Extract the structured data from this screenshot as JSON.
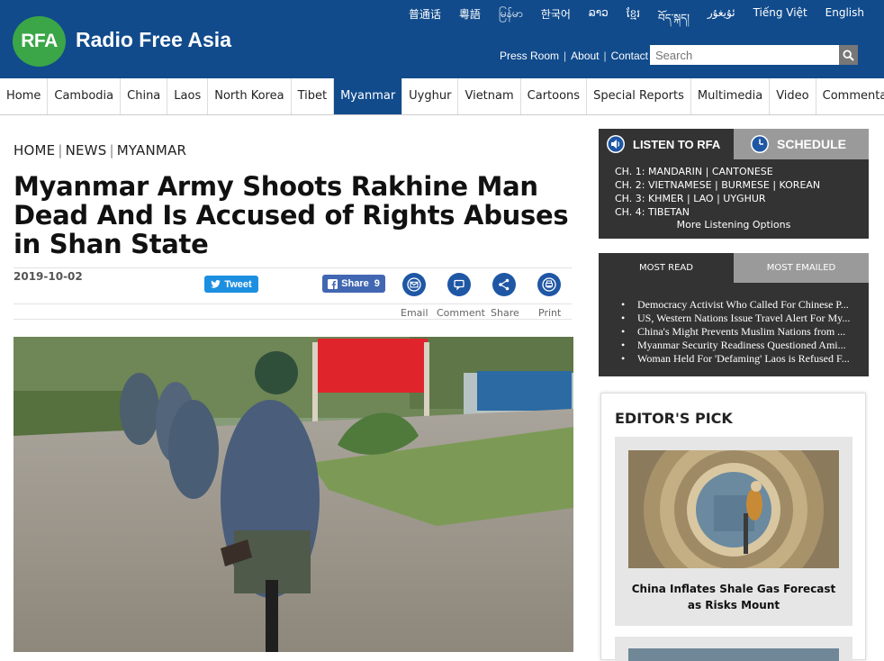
{
  "header": {
    "logo_mark": "RFA",
    "site_name": "Radio Free Asia",
    "languages": [
      "普通话",
      "粵語",
      "မြန်မာ",
      "한국어",
      "ລາວ",
      "ខ្មែរ",
      "བོད་སྐད།",
      "ئۇيغۇر",
      "Tiếng Việt",
      "English"
    ],
    "utility_links": [
      "Press Room",
      "About",
      "Contact"
    ],
    "search_placeholder": "Search",
    "brand_color": "#114b8c",
    "logo_color": "#3aa648"
  },
  "nav": {
    "items": [
      "Home",
      "Cambodia",
      "China",
      "Laos",
      "North Korea",
      "Tibet",
      "Myanmar",
      "Uyghur",
      "Vietnam",
      "Cartoons",
      "Special Reports",
      "Multimedia",
      "Video",
      "Commentaries"
    ],
    "active": "Myanmar"
  },
  "article": {
    "breadcrumb": [
      "HOME",
      "NEWS",
      "MYANMAR"
    ],
    "headline": "Myanmar Army Shoots Rakhine Man Dead And Is Accused of Rights Abuses in Shan State",
    "date": "2019-10-02",
    "tweet_label": "Tweet",
    "fb_label": "Share",
    "fb_count": "9",
    "share_actions": [
      "Email",
      "Comment",
      "Share",
      "Print"
    ]
  },
  "sidebar": {
    "listen_label": "LISTEN TO RFA",
    "schedule_label": "SCHEDULE",
    "channels": [
      "CH. 1: MANDARIN | CANTONESE",
      "CH. 2: VIETNAMESE | BURMESE | KOREAN",
      "CH. 3: KHMER | LAO | UYGHUR",
      "CH. 4: TIBETAN"
    ],
    "more_listening": "More Listening Options",
    "most_read_label": "MOST READ",
    "most_emailed_label": "MOST EMAILED",
    "most_read": [
      "Democracy Activist Who Called For Chinese P...",
      "US, Western Nations Issue Travel Alert For My...",
      "China's Might Prevents Muslim Nations from ...",
      "Myanmar Security Readiness Questioned Ami...",
      "Woman Held For 'Defaming' Laos is Refused F..."
    ],
    "editors_pick_label": "EDITOR'S PICK",
    "editors_pick_caption": "China Inflates Shale Gas Forecast as Risks Mount"
  }
}
